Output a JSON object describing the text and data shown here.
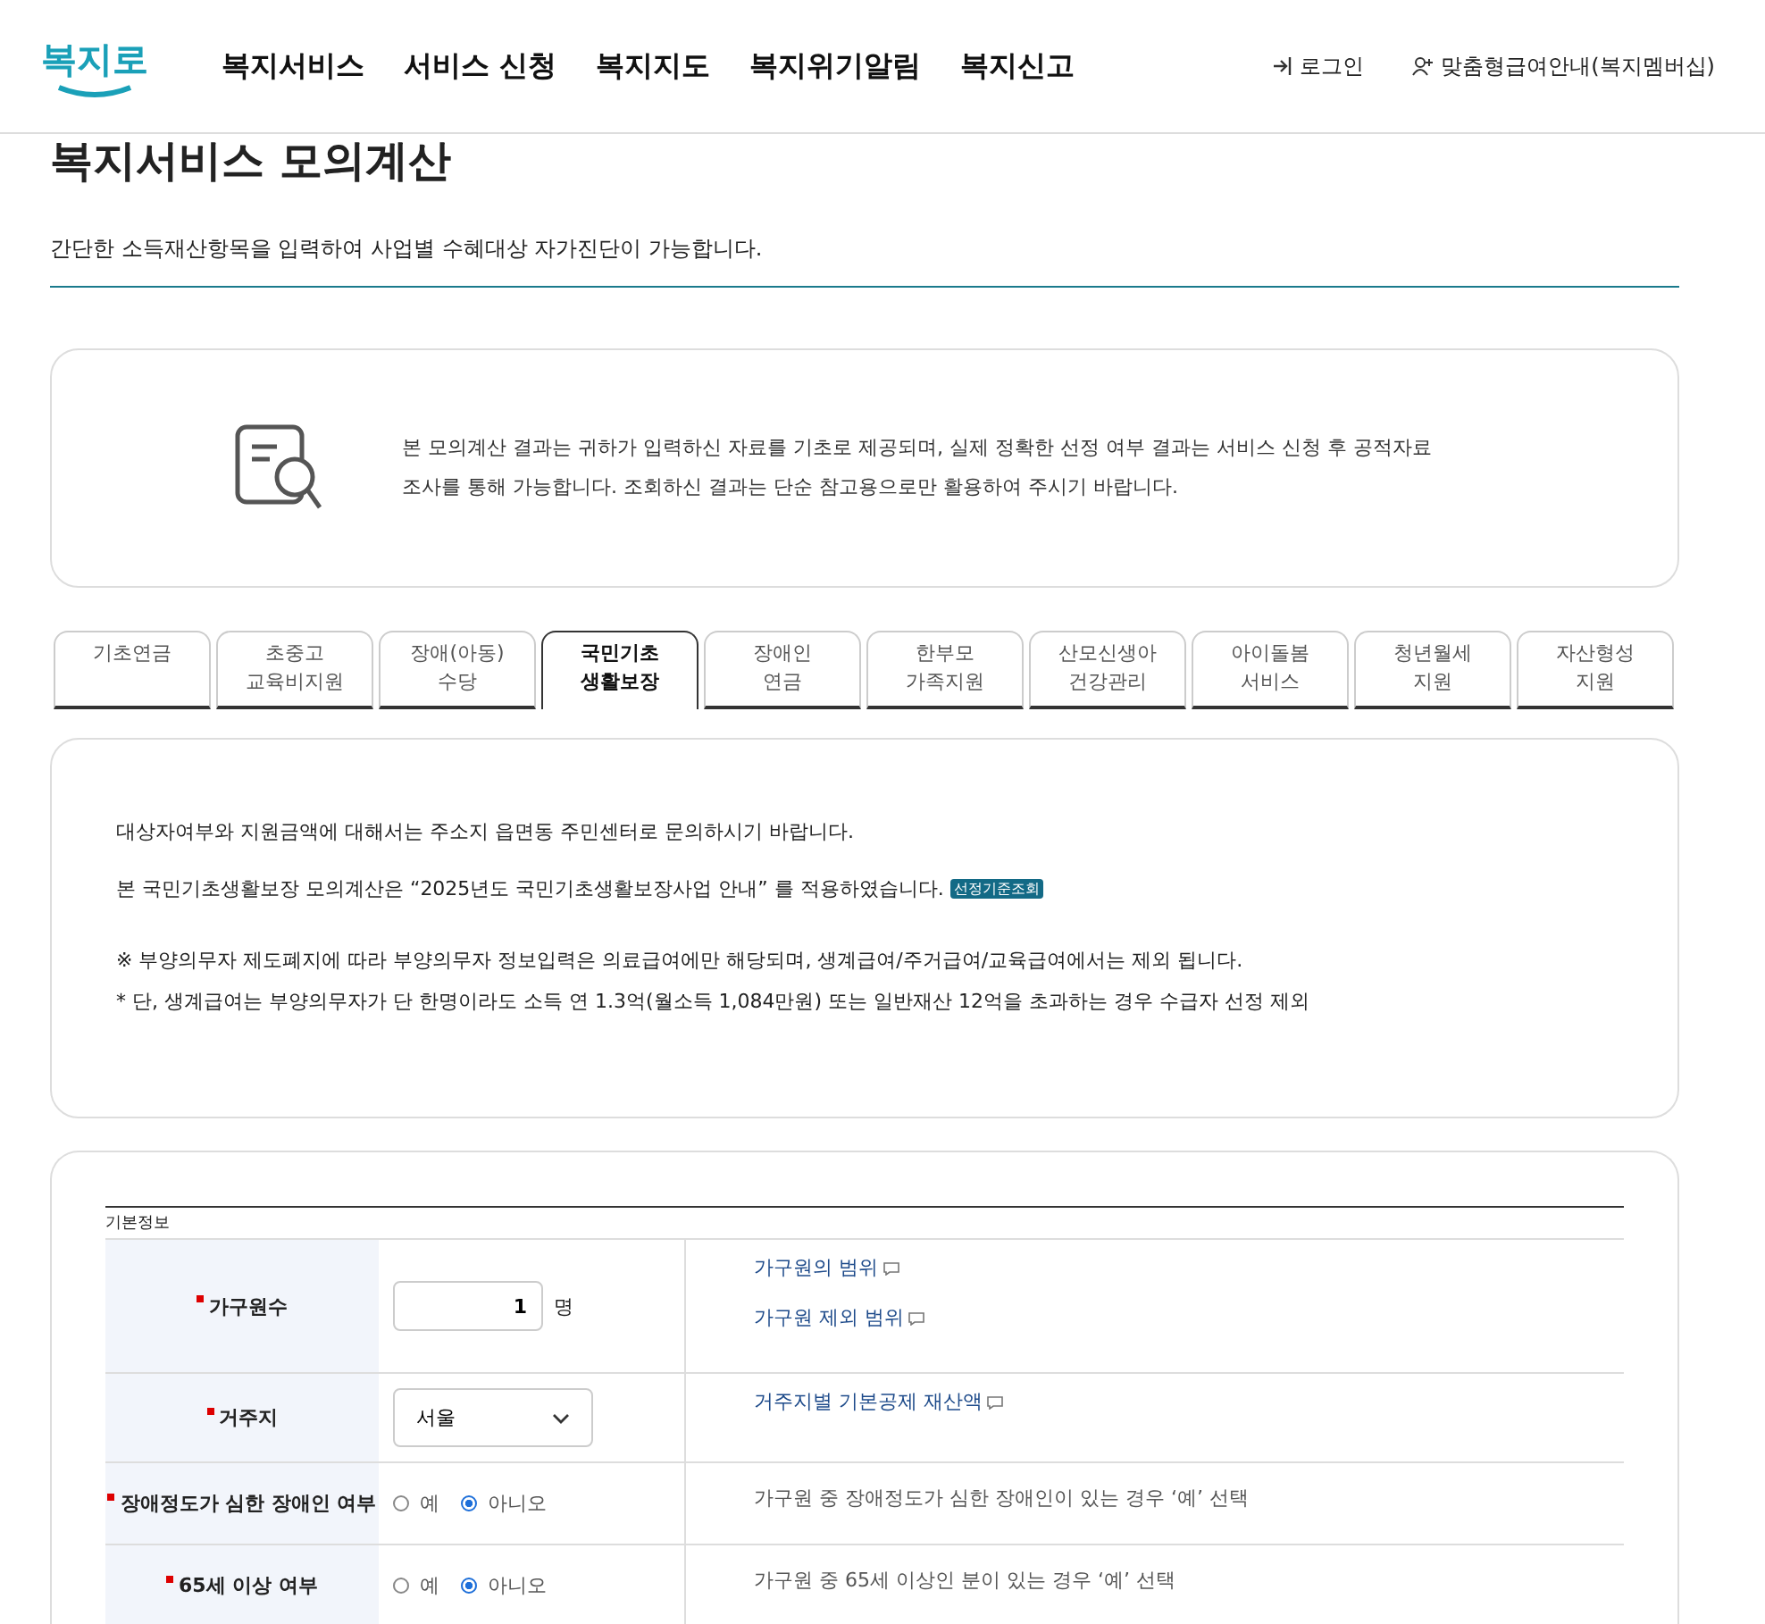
{
  "header": {
    "logo": "복지로",
    "nav": [
      "복지서비스",
      "서비스 신청",
      "복지지도",
      "복지위기알림",
      "복지신고"
    ],
    "login": "로그인",
    "membership": "맞춤형급여안내(복지멤버십)"
  },
  "page": {
    "title": "복지서비스 모의계산",
    "description": "간단한 소득재산항목을 입력하여 사업별 수혜대상 자가진단이 가능합니다."
  },
  "notice": {
    "lines": [
      "본 모의계산 결과는 귀하가 입력하신 자료를 기초로 제공되며, 실제 정확한 선정 여부 결과는 서비스 신청 후 공적자료",
      "조사를 통해 가능합니다. 조회하신 결과는 단순 참고용으로만 활용하여 주시기 바랍니다."
    ]
  },
  "tabs": [
    {
      "lines": [
        "기초연금"
      ],
      "selected": false
    },
    {
      "lines": [
        "초중고",
        "교육비지원"
      ],
      "selected": false
    },
    {
      "lines": [
        "장애(아동)",
        "수당"
      ],
      "selected": false
    },
    {
      "lines": [
        "국민기초",
        "생활보장"
      ],
      "selected": true
    },
    {
      "lines": [
        "장애인",
        "연금"
      ],
      "selected": false
    },
    {
      "lines": [
        "한부모",
        "가족지원"
      ],
      "selected": false
    },
    {
      "lines": [
        "산모신생아",
        "건강관리"
      ],
      "selected": false
    },
    {
      "lines": [
        "아이돌봄",
        "서비스"
      ],
      "selected": false
    },
    {
      "lines": [
        "청년월세",
        "지원"
      ],
      "selected": false
    },
    {
      "lines": [
        "자산형성",
        "지원"
      ],
      "selected": false
    }
  ],
  "info": {
    "contact": "대상자여부와 지원금액에 대해서는 주소지 읍면동 주민센터로 문의하시기 바랍니다.",
    "applied": "본 국민기초생활보장 모의계산은 “2025년도 국민기초생활보장사업 안내” 를 적용하였습니다.",
    "criteria_button": "선정기준조회",
    "notes": [
      "※ 부양의무자 제도폐지에 따라 부양의무자 정보입력은 의료급여에만 해당되며, 생계급여/주거급여/교육급여에서는 제외 됩니다.",
      "* 단, 생계급여는 부양의무자가 단 한명이라도 소득 연 1.3억(월소득 1,084만원) 또는 일반재산 12억을 초과하는 경우 수급자 선정 제외"
    ]
  },
  "form": {
    "section": "기본정보",
    "rows": [
      {
        "kind": "number",
        "label": "가구원수",
        "required": true,
        "value": "1",
        "unit": "명",
        "links": [
          "가구원의 범위",
          "가구원 제외 범위"
        ]
      },
      {
        "kind": "select",
        "label": "거주지",
        "required": true,
        "value": "서울",
        "links": [
          "거주지별 기본공제 재산액"
        ]
      },
      {
        "kind": "radio",
        "label": "장애정도가 심한 장애인 여부",
        "required": true,
        "options": [
          {
            "label": "예",
            "selected": false
          },
          {
            "label": "아니오",
            "selected": true
          }
        ],
        "help": "가구원 중 장애정도가 심한 장애인이 있는 경우 ‘예’ 선택"
      },
      {
        "kind": "radio",
        "label": "65세 이상 여부",
        "required": true,
        "options": [
          {
            "label": "예",
            "selected": false
          },
          {
            "label": "아니오",
            "selected": true
          }
        ],
        "help": "가구원 중 65세 이상인 분이 있는 경우 ‘예’ 선택"
      }
    ]
  }
}
